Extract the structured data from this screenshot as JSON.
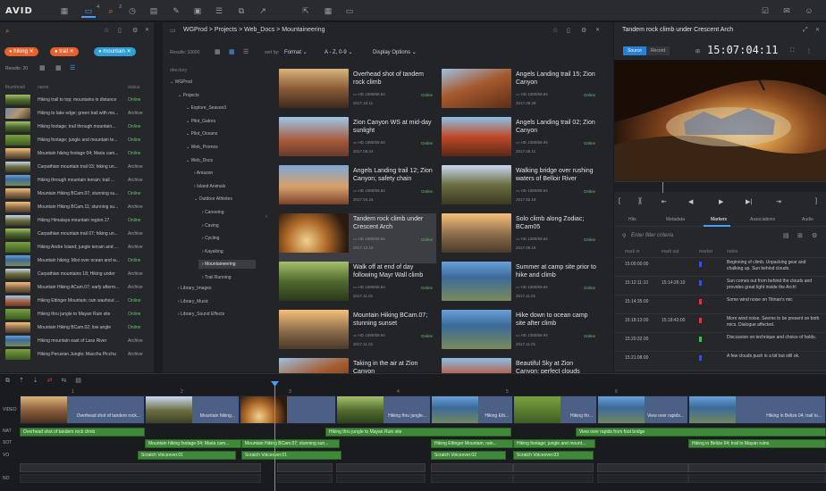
{
  "topbar": {
    "logo": "AVID",
    "badge_bin": "4",
    "badge_search": "2"
  },
  "search_panel": {
    "filters": [
      {
        "label": "hiking",
        "color": "#f0642f"
      },
      {
        "label": "trail",
        "color": "#f0642f"
      },
      {
        "label": "mountain",
        "color": "#2f9fd8"
      }
    ],
    "results": "Results: 20",
    "columns": [
      "thumbnail",
      "name",
      "status"
    ],
    "rows": [
      {
        "name": "Hiking trail to top; mountains in distance",
        "status": "Online"
      },
      {
        "name": "Hiking to lake edge; green trail with mo...",
        "status": "Archive"
      },
      {
        "name": "Hiking footage; trail through mountain...",
        "status": "Online"
      },
      {
        "name": "Hiking footage; jungle and mountain te...",
        "status": "Online"
      },
      {
        "name": "Mountain hiking footage 04; Maria cam...",
        "status": "Online"
      },
      {
        "name": "Carpathian mountain trail 03; hiking un...",
        "status": "Archive"
      },
      {
        "name": "Hiking through mountain terrain; trail ...",
        "status": "Archive"
      },
      {
        "name": "Mountain Hiking BCam.07; stunning su...",
        "status": "Online"
      },
      {
        "name": "Mountain Hiking BCam.11; stunning su...",
        "status": "Archive"
      },
      {
        "name": "Hiking Himalaya mountain region.17",
        "status": "Online"
      },
      {
        "name": "Carpathian mountain trail 07; hiking un...",
        "status": "Archive"
      },
      {
        "name": "Hiking Andre Island; jungle terrain and ...",
        "status": "Archive"
      },
      {
        "name": "Mountain hiking; Mist over ocean and w...",
        "status": "Online"
      },
      {
        "name": "Carpathian mountains 18; Hiking under",
        "status": "Archive"
      },
      {
        "name": "Mountain Hiking ACam.07; early afterm...",
        "status": "Archive"
      },
      {
        "name": "Hiking Ettinger Mountain; rain washout ...",
        "status": "Online"
      },
      {
        "name": "Hiking thru jungle to Mayan Ruin site",
        "status": "Online"
      },
      {
        "name": "Mountain Hiking BCam.02; low angle",
        "status": "Online"
      },
      {
        "name": "Hiking mountain east of Lass River",
        "status": "Archive"
      },
      {
        "name": "Hiking Peruvian Jungle; Macchu Picchu",
        "status": "Archive"
      }
    ]
  },
  "browser": {
    "breadcrumb": [
      "WGProd",
      "Projects",
      "Web_Docs",
      "Mountaineering"
    ],
    "results": "Results: 10000",
    "sort_by_label": "sort by:",
    "sort_field": "Format",
    "sort_order": "A - Z, 0-9",
    "display_options": "Display Options",
    "tree_header": "directory",
    "tree": [
      {
        "label": "WGProd",
        "depth": 0
      },
      {
        "label": "Projects",
        "depth": 1
      },
      {
        "label": "Explore_Season3",
        "depth": 2
      },
      {
        "label": "Pilot_Gators",
        "depth": 2
      },
      {
        "label": "Pilot_Oceans",
        "depth": 2
      },
      {
        "label": "Web_Promos",
        "depth": 2
      },
      {
        "label": "Web_Docs",
        "depth": 2
      },
      {
        "label": "Amazon",
        "depth": 3
      },
      {
        "label": "Island Animals",
        "depth": 3
      },
      {
        "label": "Outdoor Athletes",
        "depth": 3
      },
      {
        "label": "Canoeing",
        "depth": 4
      },
      {
        "label": "Caving",
        "depth": 4
      },
      {
        "label": "Cycling",
        "depth": 4
      },
      {
        "label": "Kayaking",
        "depth": 4
      },
      {
        "label": "Mountaineering",
        "depth": 4
      },
      {
        "label": "Trail Running",
        "depth": 4
      },
      {
        "label": "Library_Images",
        "depth": 1
      },
      {
        "label": "Library_Music",
        "depth": 1
      },
      {
        "label": "Library_Sound Effects",
        "depth": 1
      }
    ],
    "cards": [
      {
        "title": "Overhead shot of tandem rock climb",
        "meta": "HD 1080/59.94",
        "status": "Online",
        "date": "2017.10.11"
      },
      {
        "title": "Angels Landing trail 15; Zion Canyon",
        "meta": "HD 1080/59.94",
        "status": "Online",
        "date": "2017.09.28"
      },
      {
        "title": "Zion Canyon WS at mid-day sunlight",
        "meta": "HD 1080/59.94",
        "status": "Online",
        "date": "2017.08.04"
      },
      {
        "title": "Angels Landing trail 02; Zion Canyon",
        "meta": "HD 1080/59.94",
        "status": "Online",
        "date": "2017.05.11"
      },
      {
        "title": "Angels Landing trail 12; Zion Canyon; safety chain",
        "meta": "HD 1080/59.94",
        "status": "Online",
        "date": "2017.04.24"
      },
      {
        "title": "Walking bridge over rushing waters of Belloir River",
        "meta": "HD 1080/59.94",
        "status": "Online",
        "date": "2017.02.18"
      },
      {
        "title": "Tandem rock climb under Crescent Arch",
        "meta": "HD 1080/59.94",
        "status": "Online",
        "date": "2017.12.15"
      },
      {
        "title": "Solo climb along Zodiac; BCam05",
        "meta": "HD 1080/59.94",
        "status": "Online",
        "date": "2017.05.15"
      },
      {
        "title": "Walk off at end of day following Mayr Wall climb",
        "meta": "HD 1080/59.94",
        "status": "Online",
        "date": "2017.11.01"
      },
      {
        "title": "Summer at camp site prior to hike and climb",
        "meta": "HD 1080/59.94",
        "status": "Online",
        "date": "2017.11.01"
      },
      {
        "title": "Mountain Hiking BCam.07; stunning sunset",
        "meta": "HD 1080/59.94",
        "status": "Online",
        "date": "2017.11.01"
      },
      {
        "title": "Hike down to ocean camp site after climb",
        "meta": "HD 1080/59.94",
        "status": "Online",
        "date": "2017.11.01"
      },
      {
        "title": "Taking in the air at Zion Canyon",
        "meta": "",
        "status": "",
        "date": ""
      },
      {
        "title": "Beautiful Sky at Zion Canyon; perfect clouds",
        "meta": "",
        "status": "",
        "date": ""
      }
    ]
  },
  "viewer": {
    "title": "Tandem rock climb under Crescent Arch",
    "source": "Source",
    "record": "Record",
    "timecode": "15:07:04:11",
    "tabs": [
      "Hits",
      "Metadata",
      "Markers",
      "Associations",
      "Audio"
    ],
    "filter_placeholder": "Enter filter criteria",
    "marker_columns": [
      "mark in",
      "mark out",
      "marker",
      "notes"
    ],
    "markers": [
      {
        "in": "15:00:00:00",
        "out": "",
        "color": "#3a4ed8",
        "note": "Beginning of climb. Unpacking gear and chalking up. Sun behind clouds."
      },
      {
        "in": "15:12:11:10",
        "out": "15:14:26:10",
        "color": "#3a4ed8",
        "note": "Sun comes out from behind the clouds and provides great light inside the Arch!"
      },
      {
        "in": "15:14:35:00",
        "out": "",
        "color": "#d83a3a",
        "note": "Some wind noise on Tilman's mic"
      },
      {
        "in": "15:18:13:00",
        "out": "15:18:43:00",
        "color": "#d83a3a",
        "note": "More wind noise. Seems to be present on both mics. Dialogue affected."
      },
      {
        "in": "15:20:32:00",
        "out": "",
        "color": "#3fbf4a",
        "note": "Discussion on technique and choice of holds."
      },
      {
        "in": "15:21:08:00",
        "out": "",
        "color": "#3a4ed8",
        "note": "A few clouds push in a bit but still ok."
      }
    ]
  },
  "timeline": {
    "ruler": [
      "1",
      "2",
      "3",
      "4",
      "5",
      "6"
    ],
    "tracks": [
      "VIDEO",
      "NAT",
      "SOT",
      "VO",
      "NO"
    ],
    "video_clips": [
      "Overhead shot of tandem rock...",
      "Mountain hiking...",
      "Hiking thru jungle...",
      "Hiking Etti...",
      "Hiking thr...",
      "View over rapids...",
      "Hiking in Belize 04; trail to..."
    ],
    "nat_clips": [
      "Overhead shot of tandem rock climb",
      "Hiking thru jungle to Mayan Ruin site",
      "View over rapids from foot bridge"
    ],
    "sot_clips": [
      "Mountain hiking footage 04; Maria cam...",
      "Mountain Hiking BCam.07; stunning sun...",
      "Hiking Ettinger Mountain; rain...",
      "Hiking footage; jungle and mount...",
      "Hiking in Belize 04; trail to Mayan ruins."
    ],
    "vo_clips": [
      "Scratch Voiceover.01",
      "Scratch Voiceover.01",
      "Scratch Voiceover.02",
      "Scratch Voiceover.03"
    ]
  }
}
